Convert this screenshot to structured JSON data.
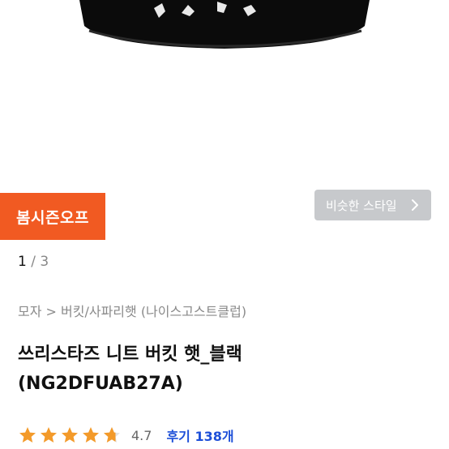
{
  "product": {
    "badge": "봄시즌오프",
    "similar_button_label": "비슷한 스타일",
    "pager": {
      "current": "1",
      "separator": "/",
      "total": "3"
    },
    "breadcrumb": "모자 > 버킷/사파리햇 (나이스고스트클럽)",
    "title_line1": "쓰리스타즈 니트 버킷 햇_블랙",
    "title_line2": "(NG2DFUAB27A)",
    "rating": {
      "value": "4.7",
      "stars": 4.7,
      "review_label": "후기 138개"
    }
  },
  "colors": {
    "accent": "#f15a22",
    "star": "#f39a2a",
    "link": "#1d4fd8",
    "similar_bg": "#c7c9cc"
  },
  "icons": [
    "chevron-right-icon",
    "star-icon"
  ]
}
